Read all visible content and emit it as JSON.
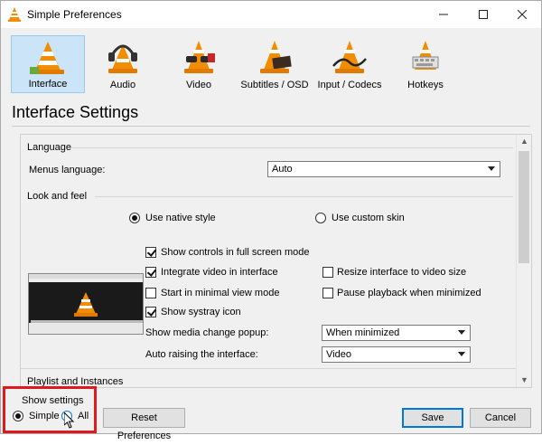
{
  "window": {
    "title": "Simple Preferences"
  },
  "categories": [
    {
      "label": "Interface",
      "icon": "vlc-cone-icon",
      "active": true
    },
    {
      "label": "Audio",
      "icon": "headphones-cone-icon",
      "active": false
    },
    {
      "label": "Video",
      "icon": "glasses-cone-icon",
      "active": false
    },
    {
      "label": "Subtitles / OSD",
      "icon": "subtitles-cone-icon",
      "active": false
    },
    {
      "label": "Input / Codecs",
      "icon": "cable-cone-icon",
      "active": false
    },
    {
      "label": "Hotkeys",
      "icon": "keyboard-cone-icon",
      "active": false
    }
  ],
  "section_title": "Interface Settings",
  "language": {
    "group": "Language",
    "menus_label": "Menus language:",
    "menus_value": "Auto"
  },
  "look": {
    "group": "Look and feel",
    "native_label": "Use native style",
    "custom_label": "Use custom skin",
    "checks": {
      "fullscreen": "Show controls in full screen mode",
      "integrate": "Integrate video in interface",
      "minimal": "Start in minimal view mode",
      "systray": "Show systray icon",
      "resize": "Resize interface to video size",
      "pause": "Pause playback when minimized"
    },
    "popup_label": "Show media change popup:",
    "popup_value": "When minimized",
    "raise_label": "Auto raising the interface:",
    "raise_value": "Video"
  },
  "playlist": {
    "group": "Playlist and Instances"
  },
  "footer": {
    "show_settings": "Show settings",
    "simple_label": "Simple",
    "all_label": "All",
    "reset_label": "Reset Preferences",
    "save_label": "Save",
    "cancel_label": "Cancel"
  },
  "colors": {
    "accent": "#0078d7",
    "highlight": "#e0191f",
    "vlc_orange": "#f28c00"
  }
}
